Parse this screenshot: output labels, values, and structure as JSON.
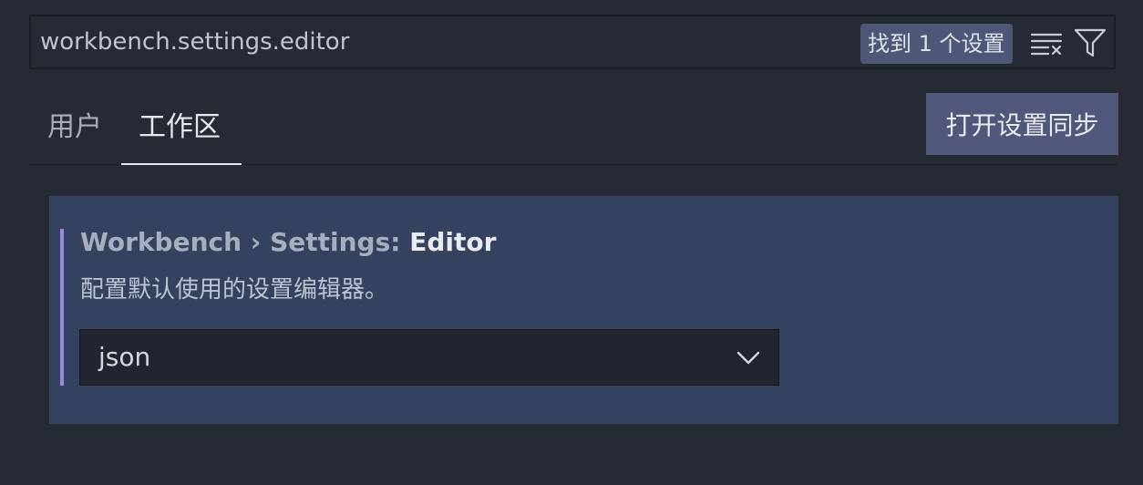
{
  "search": {
    "value": "workbench.settings.editor",
    "result_badge": "找到 1 个设置",
    "clear_icon": "clear-filter-icon",
    "filter_icon": "filter-icon"
  },
  "tabs": [
    {
      "label": "用户",
      "active": false
    },
    {
      "label": "工作区",
      "active": true
    }
  ],
  "sync_button": {
    "label": "打开设置同步"
  },
  "setting": {
    "category": "Workbench › Settings: ",
    "name": "Editor",
    "description": "配置默认使用的设置编辑器。",
    "selected_value": "json",
    "dropdown_icon": "chevron-down-icon"
  },
  "colors": {
    "background": "#262a35",
    "panel": "#34425f",
    "badge": "#4e5777",
    "sync_button": "#50577a",
    "modified_indicator": "#9b86e0"
  }
}
